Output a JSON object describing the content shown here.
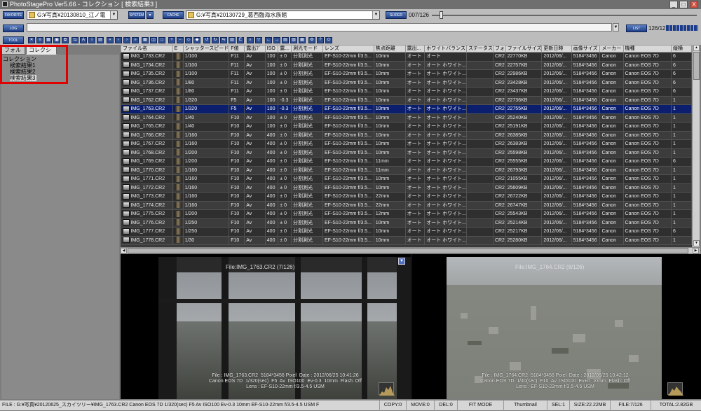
{
  "window": {
    "title": "PhotoStagePro Ver5.66 - コレクション [ 検索結果3 ]",
    "min": "_",
    "max": "□",
    "close": "X"
  },
  "toolbar1": {
    "favorite_label": "FAVORITE",
    "favorite_path": "G:¥写真¥20130810_江ノ電",
    "system_label": "SYSTEM",
    "cache_label": "CACHE",
    "cache_path": "G:¥写真¥20130729_葛西臨海水族館",
    "slider_label": "SLIDER",
    "slider_value": "007/126"
  },
  "toolbar2": {
    "log_label": "LOG",
    "list_label": "LIST",
    "list_value": "126/126"
  },
  "toolbar3": {
    "tool_label": "TOOL"
  },
  "left": {
    "tab_folder": "フォルダ",
    "tab_collection": "コレクション",
    "tree_root": "コレクション",
    "tree_items": [
      "検索結果1",
      "検索結果2",
      "検索結果3"
    ]
  },
  "table": {
    "headers": [
      "ファイル名",
      "E",
      "シャッタースピード",
      "F値",
      "露出ﾌﾟ",
      "ISO",
      "露...",
      "測光モード",
      "レンズ",
      "焦点距離",
      "露出...",
      "ホワイトバランス",
      "ステータス",
      "フォ",
      "ファイルサイズ",
      "更新日時",
      "画像サイズ",
      "メーカー",
      "機種",
      "縦横"
    ],
    "rows": [
      [
        "IMG_1733.CR2",
        "",
        "1/100",
        "F11",
        "Av",
        "100",
        "± 0",
        "分割測光",
        "EF-S10-22mm f/3.5...",
        "10mm",
        "オート",
        "オート",
        "",
        "CR2",
        "22770KB",
        "2012/06/...",
        "5184*3456",
        "Canon",
        "Canon EOS 7D",
        "6"
      ],
      [
        "IMG_1734.CR2",
        "",
        "1/100",
        "F11",
        "Av",
        "100",
        "± 0",
        "分割測光",
        "EF-S10-22mm f/3.5...",
        "10mm",
        "オート",
        "オート ホワイト...",
        "",
        "CR2",
        "22757KB",
        "2012/06/...",
        "5184*3456",
        "Canon",
        "Canon EOS 7D",
        "6"
      ],
      [
        "IMG_1735.CR2",
        "",
        "1/100",
        "F11",
        "Av",
        "100",
        "± 0",
        "分割測光",
        "EF-S10-22mm f/3.5...",
        "10mm",
        "オート",
        "オート ホワイト...",
        "",
        "CR2",
        "22986KB",
        "2012/06/...",
        "5184*3456",
        "Canon",
        "Canon EOS 7D",
        "6"
      ],
      [
        "IMG_1736.CR2",
        "",
        "1/80",
        "F11",
        "Av",
        "100",
        "± 0",
        "分割測光",
        "EF-S10-22mm f/3.5...",
        "10mm",
        "オート",
        "オート ホワイト...",
        "",
        "CR2",
        "23428KB",
        "2012/06/...",
        "5184*3456",
        "Canon",
        "Canon EOS 7D",
        "6"
      ],
      [
        "IMG_1737.CR2",
        "",
        "1/80",
        "F11",
        "Av",
        "100",
        "± 0",
        "分割測光",
        "EF-S10-22mm f/3.5...",
        "10mm",
        "オート",
        "オート ホワイト...",
        "",
        "CR2",
        "23437KB",
        "2012/06/...",
        "5184*3456",
        "Canon",
        "Canon EOS 7D",
        "6"
      ],
      [
        "IMG_1762.CR2",
        "",
        "1/320",
        "F5",
        "Av",
        "100",
        "-0.3",
        "分割測光",
        "EF-S10-22mm f/3.5...",
        "10mm",
        "オート",
        "オート ホワイト...",
        "",
        "CR2",
        "22736KB",
        "2012/06/...",
        "5184*3456",
        "Canon",
        "Canon EOS 7D",
        "1"
      ],
      [
        "IMG_1763.CR2",
        "",
        "1/320",
        "F5",
        "Av",
        "100",
        "-0.3",
        "分割測光",
        "EF-S10-22mm f/3.5...",
        "10mm",
        "オート",
        "オート ホワイト...",
        "",
        "CR2",
        "22755KB",
        "2012/06/...",
        "5184*3456",
        "Canon",
        "Canon EOS 7D",
        "1"
      ],
      [
        "IMG_1764.CR2",
        "",
        "1/40",
        "F10",
        "Av",
        "100",
        "± 0",
        "分割測光",
        "EF-S10-22mm f/3.5...",
        "10mm",
        "オート",
        "オート ホワイト...",
        "",
        "CR2",
        "25240KB",
        "2012/06/...",
        "5184*3456",
        "Canon",
        "Canon EOS 7D",
        "1"
      ],
      [
        "IMG_1765.CR2",
        "",
        "1/40",
        "F10",
        "Av",
        "100",
        "± 0",
        "分割測光",
        "EF-S10-22mm f/3.5...",
        "10mm",
        "オート",
        "オート ホワイト...",
        "",
        "CR2",
        "25191KB",
        "2012/06/...",
        "5184*3456",
        "Canon",
        "Canon EOS 7D",
        "1"
      ],
      [
        "IMG_1766.CR2",
        "",
        "1/160",
        "F10",
        "Av",
        "400",
        "± 0",
        "分割測光",
        "EF-S10-22mm f/3.5...",
        "10mm",
        "オート",
        "オート ホワイト...",
        "",
        "CR2",
        "26385KB",
        "2012/06/...",
        "5184*3456",
        "Canon",
        "Canon EOS 7D",
        "1"
      ],
      [
        "IMG_1767.CR2",
        "",
        "1/160",
        "F10",
        "Av",
        "400",
        "± 0",
        "分割測光",
        "EF-S10-22mm f/3.5...",
        "10mm",
        "オート",
        "オート ホワイト...",
        "",
        "CR2",
        "26383KB",
        "2012/06/...",
        "5184*3456",
        "Canon",
        "Canon EOS 7D",
        "1"
      ],
      [
        "IMG_1768.CR2",
        "",
        "1/200",
        "F10",
        "Av",
        "400",
        "± 0",
        "分割測光",
        "EF-S10-22mm f/3.5...",
        "10mm",
        "オート",
        "オート ホワイト...",
        "",
        "CR2",
        "25598KB",
        "2012/06/...",
        "5184*3456",
        "Canon",
        "Canon EOS 7D",
        "1"
      ],
      [
        "IMG_1769.CR2",
        "",
        "1/200",
        "F10",
        "Av",
        "400",
        "± 0",
        "分割測光",
        "EF-S10-22mm f/3.5...",
        "11mm",
        "オート",
        "オート ホワイト...",
        "",
        "CR2",
        "25555KB",
        "2012/06/...",
        "5184*3456",
        "Canon",
        "Canon EOS 7D",
        "6"
      ],
      [
        "IMG_1770.CR2",
        "",
        "1/160",
        "F10",
        "Av",
        "400",
        "± 0",
        "分割測光",
        "EF-S10-22mm f/3.5...",
        "11mm",
        "オート",
        "オート ホワイト...",
        "",
        "CR2",
        "26793KB",
        "2012/06/...",
        "5184*3456",
        "Canon",
        "Canon EOS 7D",
        "1"
      ],
      [
        "IMG_1771.CR2",
        "",
        "1/160",
        "F10",
        "Av",
        "400",
        "± 0",
        "分割測光",
        "EF-S10-22mm f/3.5...",
        "10mm",
        "オート",
        "オート ホワイト...",
        "",
        "CR2",
        "21055KB",
        "2012/06/...",
        "5184*3456",
        "Canon",
        "Canon EOS 7D",
        "1"
      ],
      [
        "IMG_1772.CR2",
        "",
        "1/160",
        "F10",
        "Av",
        "400",
        "± 0",
        "分割測光",
        "EF-S10-22mm f/3.5...",
        "10mm",
        "オート",
        "オート ホワイト...",
        "",
        "CR2",
        "25609KB",
        "2012/06/...",
        "5184*3456",
        "Canon",
        "Canon EOS 7D",
        "1"
      ],
      [
        "IMG_1773.CR2",
        "",
        "1/160",
        "F10",
        "Av",
        "400",
        "± 0",
        "分割測光",
        "EF-S10-22mm f/3.5...",
        "22mm",
        "オート",
        "オート ホワイト...",
        "",
        "CR2",
        "26722KB",
        "2012/06/...",
        "5184*3456",
        "Canon",
        "Canon EOS 7D",
        "1"
      ],
      [
        "IMG_1774.CR2",
        "",
        "1/160",
        "F10",
        "Av",
        "400",
        "± 0",
        "分割測光",
        "EF-S10-22mm f/3.5...",
        "22mm",
        "オート",
        "オート ホワイト...",
        "",
        "CR2",
        "26747KB",
        "2012/06/...",
        "5184*3456",
        "Canon",
        "Canon EOS 7D",
        "1"
      ],
      [
        "IMG_1775.CR2",
        "",
        "1/200",
        "F10",
        "Av",
        "400",
        "± 0",
        "分割測光",
        "EF-S10-22mm f/3.5...",
        "12mm",
        "オート",
        "オート ホワイト...",
        "",
        "CR2",
        "25543KB",
        "2012/06/...",
        "5184*3456",
        "Canon",
        "Canon EOS 7D",
        "1"
      ],
      [
        "IMG_1776.CR2",
        "",
        "1/250",
        "F10",
        "Av",
        "400",
        "± 0",
        "分割測光",
        "EF-S10-22mm f/3.5...",
        "10mm",
        "オート",
        "オート ホワイト...",
        "",
        "CR2",
        "25214KB",
        "2012/06/...",
        "5184*3456",
        "Canon",
        "Canon EOS 7D",
        "1"
      ],
      [
        "IMG_1777.CR2",
        "",
        "1/250",
        "F10",
        "Av",
        "400",
        "± 0",
        "分割測光",
        "EF-S10-22mm f/3.5...",
        "10mm",
        "オート",
        "オート ホワイト...",
        "",
        "CR2",
        "25217KB",
        "2012/06/...",
        "5184*3456",
        "Canon",
        "Canon EOS 7D",
        "6"
      ],
      [
        "IMG_1778.CR2",
        "",
        "1/30",
        "F10",
        "Av",
        "400",
        "± 0",
        "分割測光",
        "EF-S10-22mm f/3.5...",
        "10mm",
        "オート",
        "オート ホワイト...",
        "",
        "CR2",
        "25280KB",
        "2012/06/...",
        "5184*3456",
        "Canon",
        "Canon EOS 7D",
        "1"
      ]
    ],
    "selected_index": 6
  },
  "preview_left": {
    "title": "File:IMG_1763.CR2   (7/126)",
    "info": "File : IMG_1763.CR2  5184*3456 Pixel  Date : 2012/06/25 10:41:26\nCanon EOS 7D  1/320(sec)  F5  Av  ISO100  Ev-0.3  10mm  Flash: Off\nLens : EF-S10-22mm f/3.5-4.5 USM"
  },
  "preview_right": {
    "title": "File:IMG_1764.CR2   (8/126)",
    "info": "File : IMG_1764.CR2  5184*3456 Pixel  Date : 2012/06/25 10:42:12\nCanon EOS 7D  1/40(sec)  F10  Av  ISO100  Ev±0  10mm  Flash: Off\nLens : EF-S10-22mm f/3.5-4.5 USM"
  },
  "status": {
    "path": "FILE : G:¥写真¥20120625_スカイツリー¥IMG_1763.CR2  Canon EOS 7D  1/320(sec)  F5  Av  ISO100  Ev-0.3  10mm  EF-S10-22mm f/3.5-4.5 USM  F",
    "copy": "COPY:0",
    "move": "MOVE:0",
    "del": "DEL:0",
    "mode": "FIT MODE",
    "view": "Thumbnail",
    "sel": "SEL:1",
    "size": "SIZE:22.22MB",
    "file": "FILE:7/126",
    "total": "TOTAL:2.82GB"
  }
}
